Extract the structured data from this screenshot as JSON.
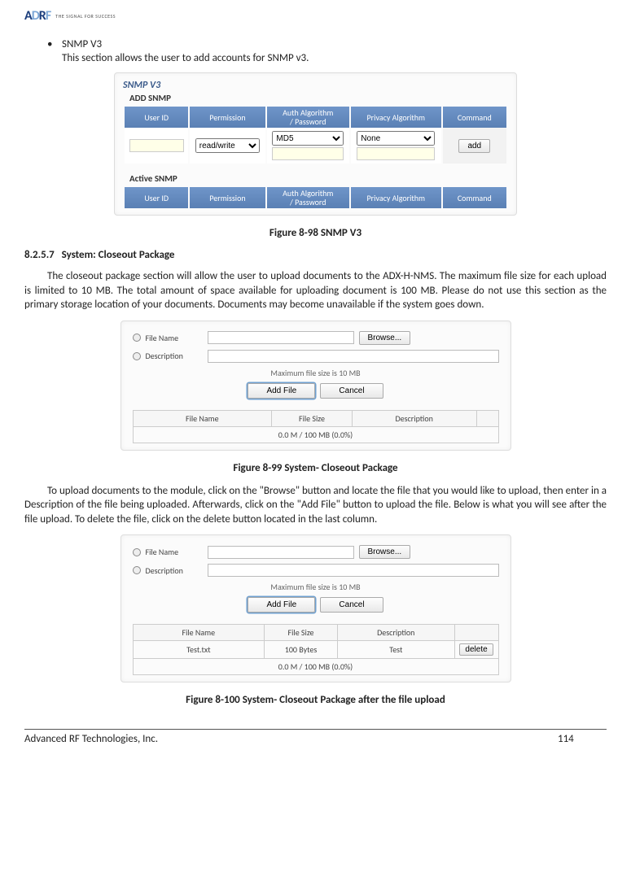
{
  "header": {
    "logo_text": "ADRF",
    "tagline": "THE SIGNAL FOR SUCCESS"
  },
  "bullet": {
    "title": "SNMP V3",
    "desc": "This section allows the user to add accounts for SNMP v3."
  },
  "fig98": {
    "title": "SNMP V3",
    "add_label": "ADD SNMP",
    "cols": {
      "c1": "User ID",
      "c2": "Permission",
      "c3a": "Auth Algorithm",
      "c3b": "/ Password",
      "c4": "Privacy Algorithm",
      "c5": "Command"
    },
    "perm_value": "read/write",
    "auth_value": "MD5",
    "priv_value": "None",
    "add_btn": "add",
    "active_label": "Active SNMP",
    "caption": "Figure 8-98    SNMP V3"
  },
  "sec": {
    "num": "8.2.5.7",
    "title": "System: Closeout Package"
  },
  "para1": "The closeout package section will allow the user to upload documents to the ADX-H-NMS.  The maximum file size for each upload is limited to 10 MB.  The total amount of space available for uploading document is 100 MB.  Please do not use this section as the primary storage location of your documents.  Documents may become unavailable if the system goes down.",
  "closeout": {
    "file_label": "File Name",
    "desc_label": "Description",
    "browse": "Browse...",
    "hint": "Maximum file size is 10 MB",
    "add": "Add File",
    "cancel": "Cancel",
    "th1": "File Name",
    "th2": "File Size",
    "th3": "Description",
    "usage": "0.0 M / 100 MB (0.0%)"
  },
  "fig99_caption": "Figure 8-99    System- Closeout Package",
  "para2": "To upload documents to the module, click on the \"Browse\" button and locate the file that you would like to upload, then enter in a Description of the file being uploaded.  Afterwards, click on the \"Add File\" button to upload the file.  Below is what you will see after the file upload.  To delete the file, click on the delete button located in the last column.",
  "fig100": {
    "row_fn": "Test.txt",
    "row_fs": "100 Bytes",
    "row_desc": "Test",
    "delete": "delete",
    "caption": "Figure 8-100 System- Closeout Package after the file upload"
  },
  "footer": {
    "company": "Advanced RF Technologies, Inc.",
    "page": "114"
  }
}
